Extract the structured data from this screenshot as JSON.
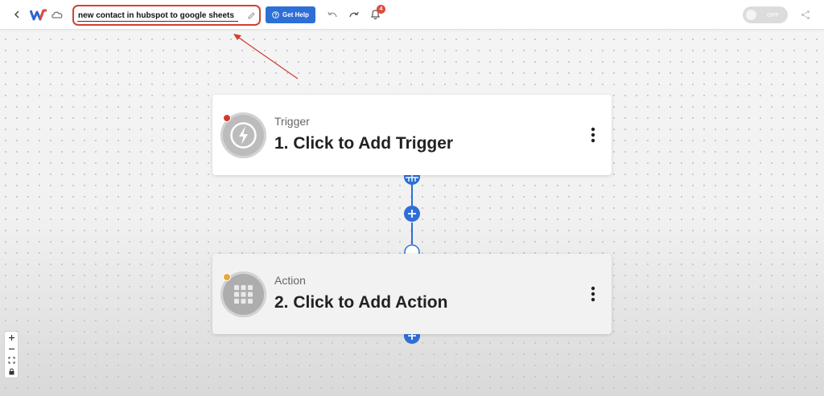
{
  "topbar": {
    "workflow_name": "new contact in hubspot to google sheets",
    "help_button_label": "Get Help",
    "notification_count": "4",
    "toggle_label": "OFF",
    "toggle_on": false
  },
  "trigger_card": {
    "label": "Trigger",
    "title": "1. Click to Add Trigger",
    "icon": "lightning-icon",
    "status_color": "#d33a2f"
  },
  "action_card": {
    "label": "Action",
    "title": "2. Click to Add Action",
    "icon": "grid-apps-icon",
    "status_color": "#e8a93a"
  },
  "zoom_controls": [
    "zoom-in-icon",
    "zoom-out-icon",
    "fit-view-icon",
    "lock-icon"
  ],
  "colors": {
    "accent": "#2d6fd6",
    "annotation": "#d04133",
    "badge": "#e04a3c"
  }
}
